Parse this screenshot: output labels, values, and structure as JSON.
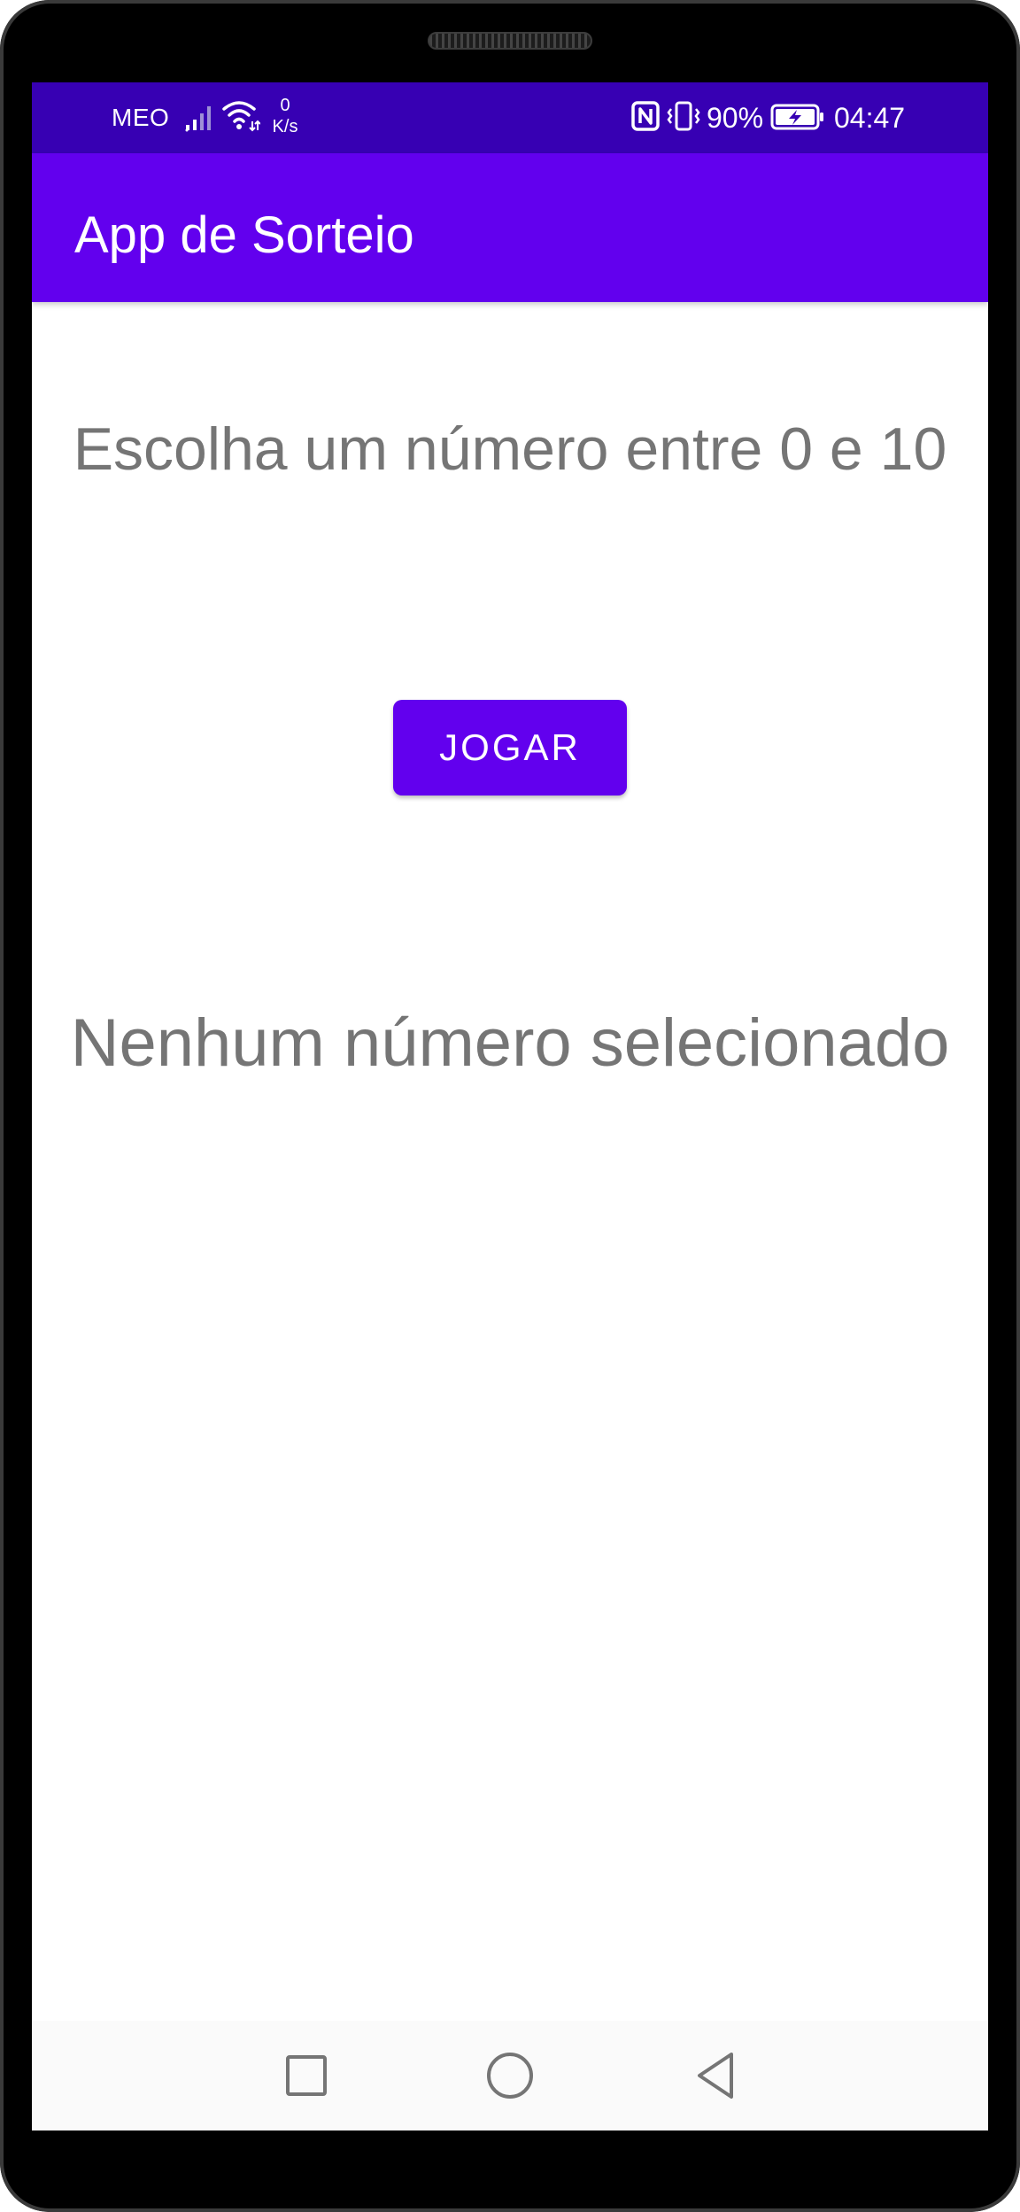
{
  "status_bar": {
    "carrier": "MEO",
    "speed_value": "0",
    "speed_unit": "K/s",
    "battery_percent": "90%",
    "time": "04:47",
    "icons": [
      "signal-icon",
      "wifi-icon",
      "nfc-icon",
      "vibrate-icon",
      "battery-charging-icon"
    ]
  },
  "app_bar": {
    "title": "App de Sorteio"
  },
  "main": {
    "prompt": "Escolha um número entre 0 e 10",
    "play_button_label": "JOGAR",
    "result_text": "Nenhum número selecionado"
  },
  "nav_bar": {
    "icons": [
      "recents-icon",
      "home-icon",
      "back-icon"
    ]
  },
  "colors": {
    "status_bar": "#3700b3",
    "primary": "#6200ee",
    "body_text": "#757575",
    "nav_icon": "#757575"
  }
}
